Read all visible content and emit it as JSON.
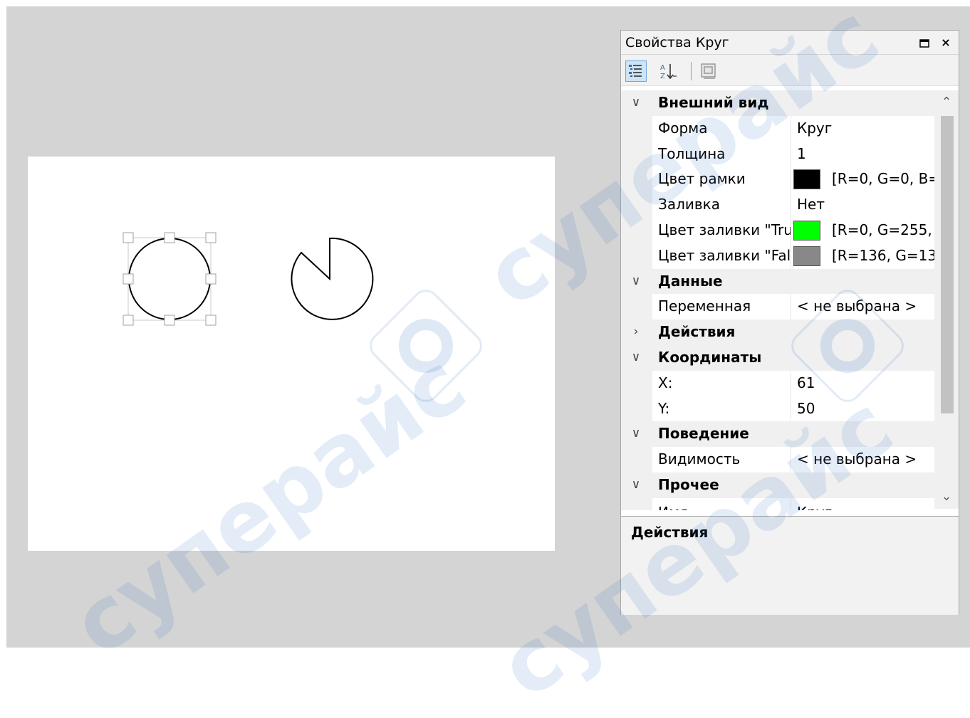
{
  "panel": {
    "title": "Свойства Круг",
    "title_buttons": [
      "maximize-icon",
      "close-icon"
    ],
    "close_glyph": "×",
    "toolbar": [
      "categorized-view-icon",
      "alphabetical-sort-icon",
      "property-pages-icon"
    ]
  },
  "grid": {
    "cat_appearance": "Внешний вид",
    "shape": {
      "name": "Форма",
      "value": "Круг"
    },
    "thickness": {
      "name": "Толщина",
      "value": "1"
    },
    "border_color": {
      "name": "Цвет рамки",
      "value": "[R=0, G=0, B=",
      "swatch": "#000000"
    },
    "fill": {
      "name": "Заливка",
      "value": "Нет"
    },
    "fill_true": {
      "name": "Цвет заливки \"Tru",
      "value": "[R=0, G=255, l",
      "swatch": "#00ff00"
    },
    "fill_false": {
      "name": "Цвет заливки \"Fal",
      "value": "[R=136, G=13(",
      "swatch": "#888888"
    },
    "cat_data": "Данные",
    "variable": {
      "name": "Переменная",
      "value": "< не выбрана >"
    },
    "cat_actions": "Действия",
    "cat_coords": "Координаты",
    "x": {
      "name": "X:",
      "value": "61"
    },
    "y": {
      "name": "Y:",
      "value": "50"
    },
    "cat_behavior": "Поведение",
    "visibility": {
      "name": "Видимость",
      "value": "< не выбрана >"
    },
    "cat_other": "Прочее",
    "partial_row": {
      "name": "Имя",
      "value": "Круг"
    }
  },
  "description": {
    "title": "Действия"
  },
  "watermark": {
    "text": "cyпepaйc"
  },
  "colors": {
    "workspace": "#d4d4d4",
    "canvas": "#ffffff",
    "selection_handles": "#a0a0a0",
    "toolbar_active": "#cce4f7"
  }
}
